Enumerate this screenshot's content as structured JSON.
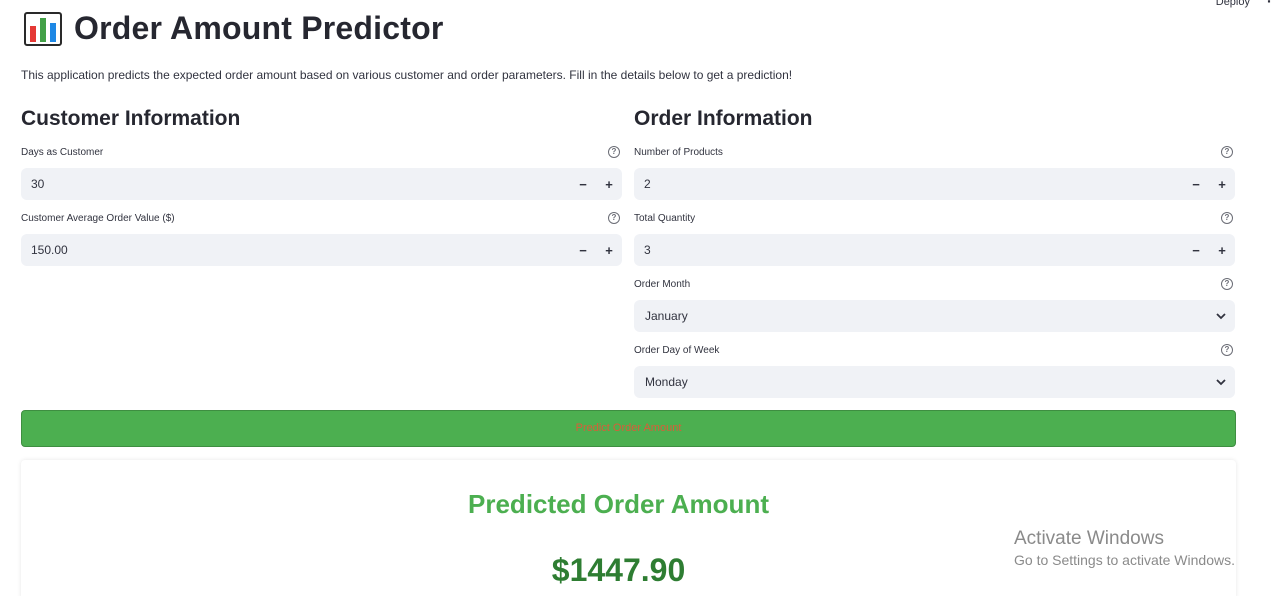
{
  "header": {
    "deploy_label": "Deploy",
    "menu_glyph": "⋮",
    "title_icon": "bar-chart-icon",
    "title": "Order Amount Predictor",
    "intro": "This application predicts the expected order amount based on various customer and order parameters. Fill in the details below to get a prediction!"
  },
  "customer": {
    "heading": "Customer Information",
    "days": {
      "label": "Days as Customer",
      "value": "30"
    },
    "avg_value": {
      "label": "Customer Average Order Value ($)",
      "value": "150.00"
    }
  },
  "order": {
    "heading": "Order Information",
    "num_products": {
      "label": "Number of Products",
      "value": "2"
    },
    "total_quantity": {
      "label": "Total Quantity",
      "value": "3"
    },
    "month": {
      "label": "Order Month",
      "value": "January"
    },
    "day_of_week": {
      "label": "Order Day of Week",
      "value": "Monday"
    }
  },
  "stepper": {
    "minus": "−",
    "plus": "+"
  },
  "help_glyph": "?",
  "predict_button": "Predict Order Amount",
  "result": {
    "heading": "Predicted Order Amount",
    "value": "$1447.90"
  },
  "watermark": {
    "line1": "Activate Windows",
    "line2": "Go to Settings to activate Windows."
  },
  "colors": {
    "accent_green": "#4caf50",
    "value_green": "#2e7d32",
    "button_text": "#d95d39",
    "input_bg": "#f0f2f6"
  }
}
